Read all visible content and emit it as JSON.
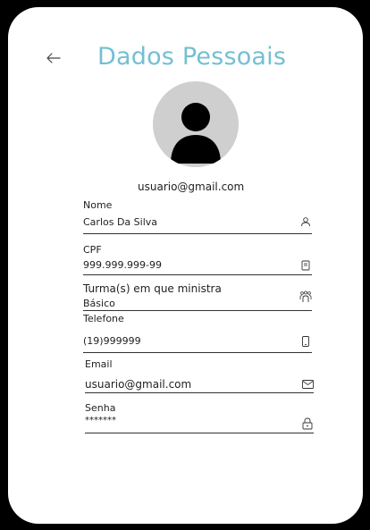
{
  "header": {
    "back_icon": "arrow-left-icon",
    "title": "Dados Pessoais",
    "accent_color": "#74bfd3"
  },
  "profile": {
    "avatar_icon": "user-avatar-icon",
    "email": "usuario@gmail.com"
  },
  "fields": {
    "nome": {
      "label": "Nome",
      "value": "Carlos Da Silva",
      "icon": "person-icon"
    },
    "cpf": {
      "label": "CPF",
      "value": "999.999.999-99",
      "icon": "document-icon"
    },
    "turmas": {
      "label": "Turma(s) em que ministra",
      "value": "Básico",
      "icon": "group-icon"
    },
    "telefone": {
      "label": "Telefone",
      "value": "(19)999999",
      "icon": "phone-icon"
    },
    "email": {
      "label": "Email",
      "value": "usuario@gmail.com",
      "icon": "envelope-icon"
    },
    "senha": {
      "label": "Senha",
      "value": "*******",
      "icon": "lock-icon"
    }
  }
}
